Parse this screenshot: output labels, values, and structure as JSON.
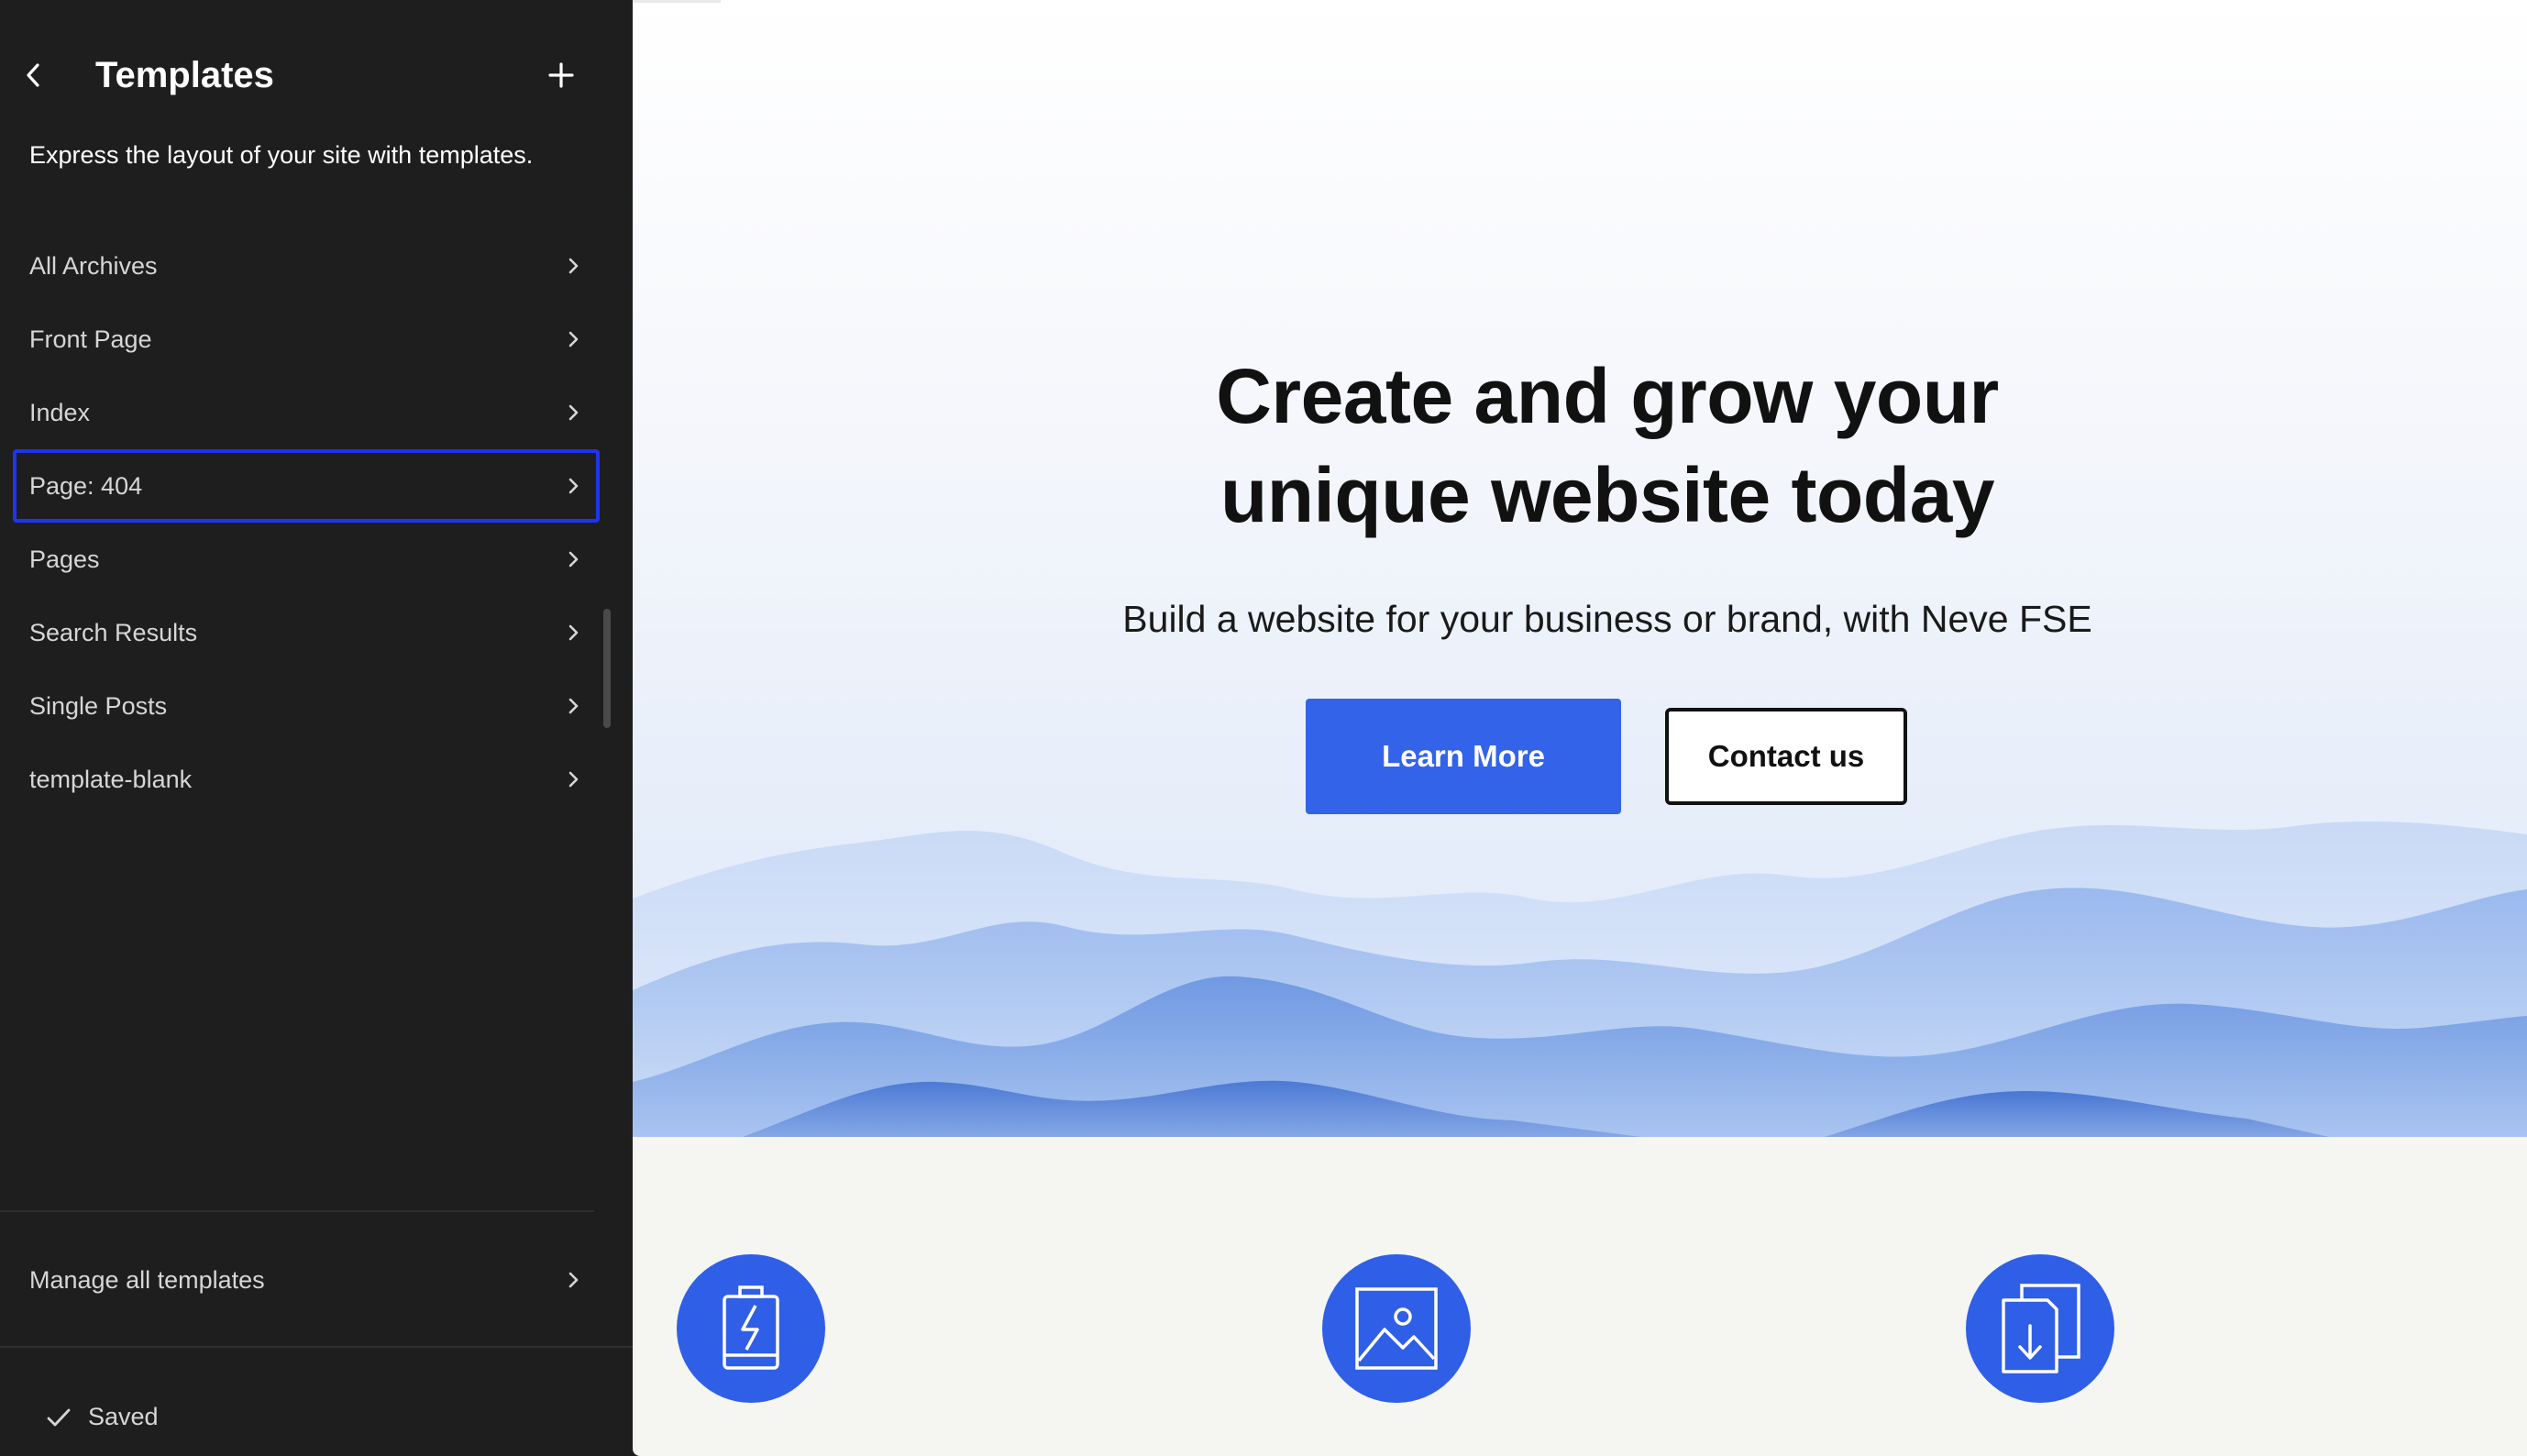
{
  "sidebar": {
    "back_icon": "chevron-left-icon",
    "title": "Templates",
    "add_icon": "plus-icon",
    "description": "Express the layout of your site with templates.",
    "items": [
      {
        "label": "All Archives",
        "selected": false
      },
      {
        "label": "Front Page",
        "selected": false
      },
      {
        "label": "Index",
        "selected": false
      },
      {
        "label": "Page: 404",
        "selected": true
      },
      {
        "label": "Pages",
        "selected": false
      },
      {
        "label": "Search Results",
        "selected": false
      },
      {
        "label": "Single Posts",
        "selected": false
      },
      {
        "label": "template-blank",
        "selected": false
      }
    ],
    "manage_label": "Manage all templates",
    "status": "Saved",
    "status_icon": "check-icon"
  },
  "preview": {
    "hero": {
      "title_line1": "Create and grow your",
      "title_line2": "unique website today",
      "subtitle": "Build a website for your business or brand, with Neve FSE",
      "primary_button": "Learn More",
      "secondary_button": "Contact us"
    },
    "features": [
      {
        "icon": "battery-bolt-icon"
      },
      {
        "icon": "image-icon"
      },
      {
        "icon": "document-download-icon"
      }
    ]
  },
  "colors": {
    "sidebar_bg": "#1e1e1e",
    "selected_outline": "#1d35f0",
    "accent": "#3363e8",
    "feature_circle": "#2f5fe6"
  }
}
